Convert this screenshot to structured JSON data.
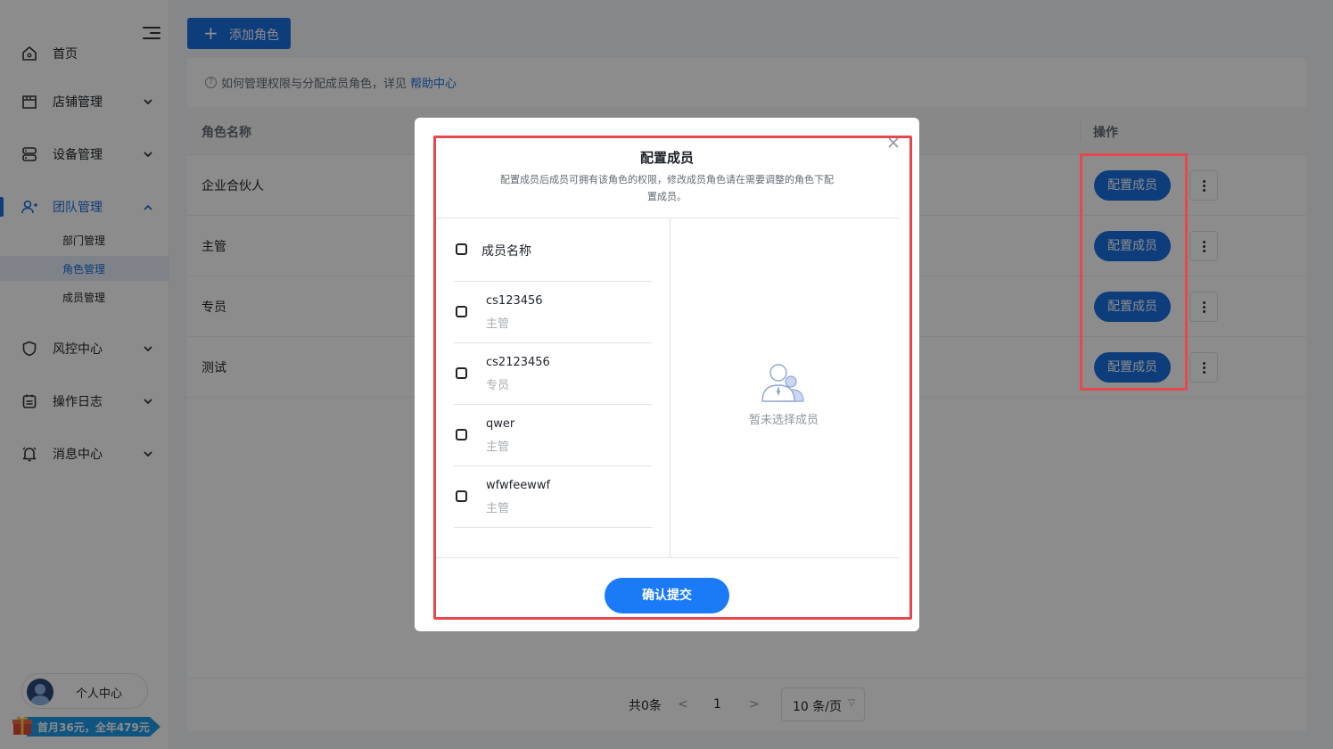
{
  "sidebar": {
    "items": [
      {
        "label": "首页",
        "icon": "home-icon"
      },
      {
        "label": "店铺管理",
        "icon": "store-icon"
      },
      {
        "label": "设备管理",
        "icon": "device-icon"
      },
      {
        "label": "团队管理",
        "icon": "team-icon"
      },
      {
        "label": "风控中心",
        "icon": "shield-icon"
      },
      {
        "label": "操作日志",
        "icon": "log-icon"
      },
      {
        "label": "消息中心",
        "icon": "bell-icon"
      }
    ],
    "sub_items": [
      {
        "label": "部门管理"
      },
      {
        "label": "角色管理"
      },
      {
        "label": "成员管理"
      }
    ],
    "profile_label": "个人中心",
    "promo_label": "首月36元，全年479元",
    "accent": "#1b6fe0"
  },
  "toolbar": {
    "add_role_label": "添加角色"
  },
  "hint": {
    "text": "如何管理权限与分配成员角色，详见",
    "link": "帮助中心"
  },
  "table": {
    "headers": [
      "角色名称",
      "操作"
    ],
    "rows": [
      {
        "name": "企业合伙人",
        "action": "配置成员"
      },
      {
        "name": "主管",
        "action": "配置成员"
      },
      {
        "name": "专员",
        "action": "配置成员"
      },
      {
        "name": "测试",
        "action": "配置成员"
      }
    ]
  },
  "pagination": {
    "total": "共0条",
    "prev": "<",
    "page": "1",
    "next": ">",
    "page_size": "10 条/页"
  },
  "modal": {
    "title": "配置成员",
    "desc": "配置成员后成员可拥有该角色的权限，修改成员角色请在需要调整的角色下配置成员。",
    "select_all_label": "成员名称",
    "members": [
      {
        "name": "cs123456",
        "role": "主管"
      },
      {
        "name": "cs2123456",
        "role": "专员"
      },
      {
        "name": "qwer",
        "role": "主管"
      },
      {
        "name": "wfwfeewwf",
        "role": "主管"
      }
    ],
    "empty_text": "暂未选择成员",
    "submit_label": "确认提交"
  }
}
